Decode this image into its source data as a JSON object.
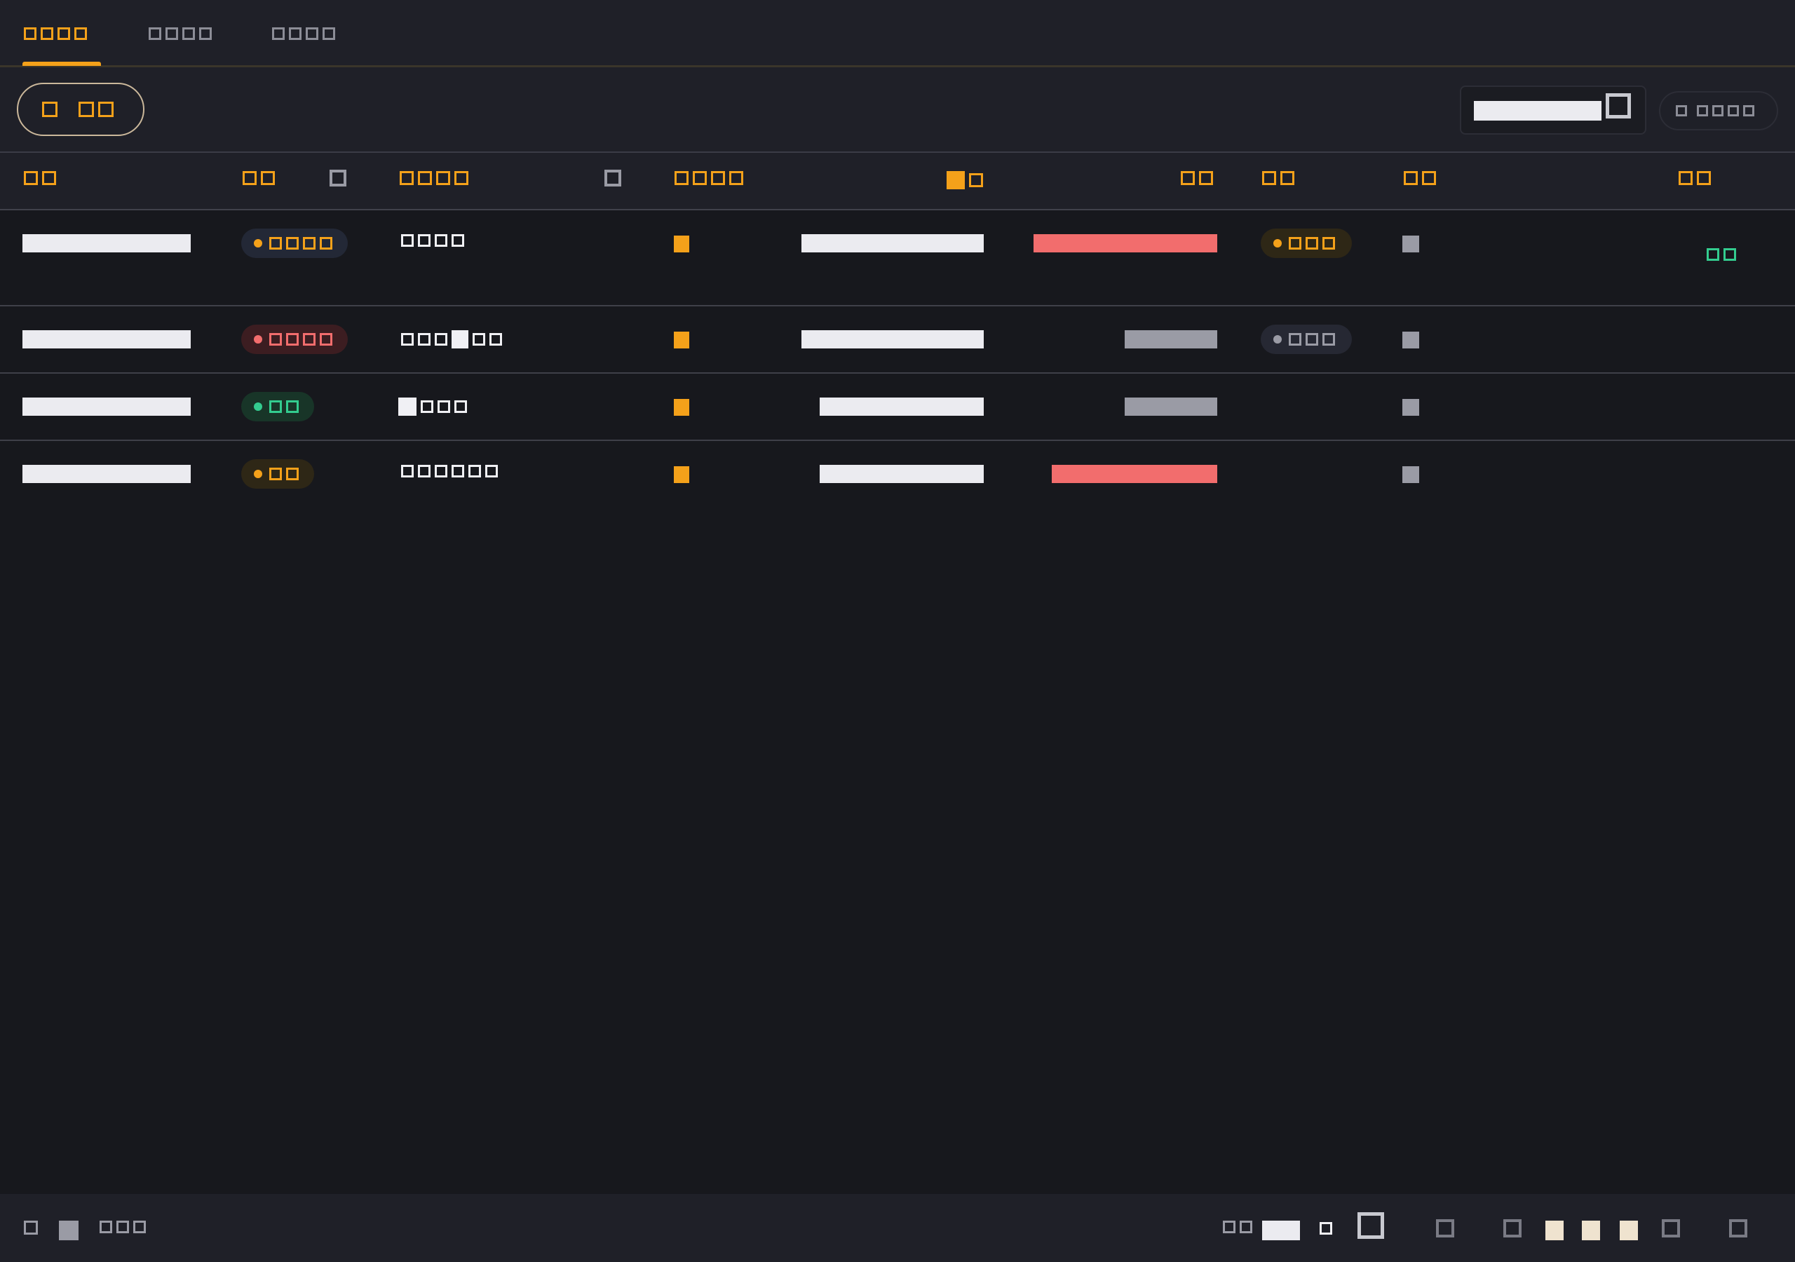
{
  "tabs": [
    {
      "label": "□□□□",
      "glyphs": 4,
      "active": true
    },
    {
      "label": "□□□□",
      "glyphs": 4,
      "active": false
    },
    {
      "label": "□□□□",
      "glyphs": 4,
      "active": false
    }
  ],
  "toolbar": {
    "filter_label": "□ □□",
    "search_value": "",
    "view_label": "□ □□□□"
  },
  "columns": [
    {
      "label": "□□",
      "glyphs": 2
    },
    {
      "label": "□□",
      "glyphs": 2,
      "sortable": true
    },
    {
      "label": "□□□□",
      "glyphs": 4,
      "sortable": true
    },
    {
      "label": "□□□□",
      "glyphs": 4
    },
    {
      "label": "■□",
      "glyphs": 2
    },
    {
      "label": "□□",
      "glyphs": 2
    },
    {
      "label": "□□",
      "glyphs": 2
    },
    {
      "label": "□□",
      "glyphs": 2
    },
    {
      "label": "□□",
      "glyphs": 2
    }
  ],
  "rows": [
    {
      "id": "",
      "status": {
        "label": "□□□□",
        "glyphs": 4,
        "tone": "navy"
      },
      "name": "□□□□",
      "marker": "orange",
      "amount_bar": "white-long",
      "change": {
        "tone": "red",
        "width": "long"
      },
      "tag": {
        "label": "□□□",
        "glyphs": 3,
        "tone": "amber"
      },
      "flag": "gray",
      "extra": {
        "label": "□□",
        "color": "#33cc8f"
      }
    },
    {
      "id": "",
      "status": {
        "label": "□□□□",
        "glyphs": 4,
        "tone": "red"
      },
      "name": "□□□■□□",
      "marker": "orange",
      "amount_bar": "white-long",
      "change": {
        "tone": "gray",
        "width": "short"
      },
      "tag": {
        "label": "□□□",
        "glyphs": 3,
        "tone": "slate"
      },
      "flag": "gray",
      "extra": null
    },
    {
      "id": "",
      "status": {
        "label": "□□",
        "glyphs": 2,
        "tone": "green"
      },
      "name": "■□□□",
      "marker": "orange",
      "amount_bar": "white-short",
      "change": {
        "tone": "gray",
        "width": "short"
      },
      "tag": null,
      "flag": "gray",
      "extra": null
    },
    {
      "id": "",
      "status": {
        "label": "□□",
        "glyphs": 2,
        "tone": "amber"
      },
      "name": "□□□□□□",
      "marker": "orange",
      "amount_bar": "white-short",
      "change": {
        "tone": "red",
        "width": "medium"
      },
      "tag": null,
      "flag": "gray",
      "extra": null
    }
  ],
  "footer": {
    "left_label": "□□□",
    "page_label": "□□"
  },
  "colors": {
    "accent": "#f4a11a",
    "danger": "#f26d6d",
    "success": "#33cc8f",
    "muted": "#9a9ba5",
    "background": "#17181d",
    "surface": "#1f2028"
  }
}
